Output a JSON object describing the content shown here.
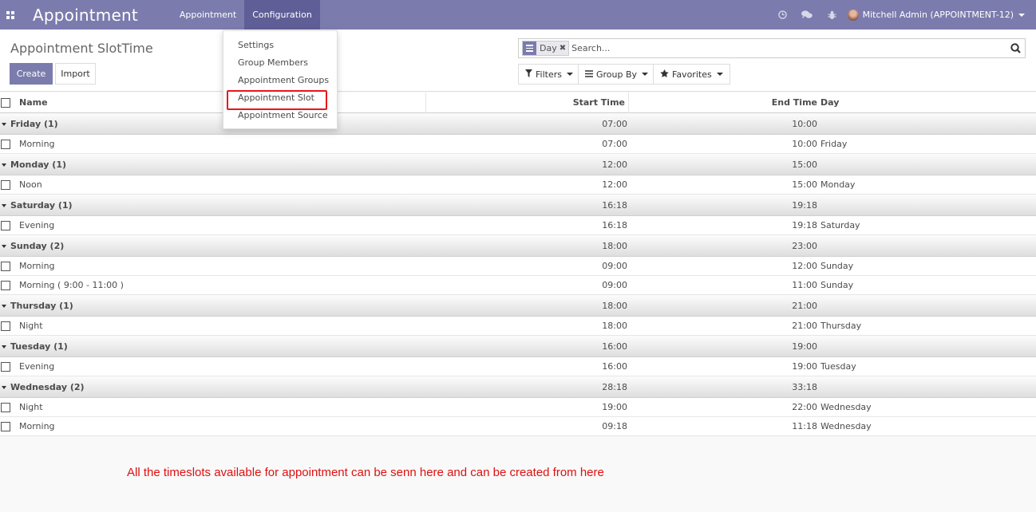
{
  "navbar": {
    "brand": "Appointment",
    "menus": [
      {
        "label": "Appointment",
        "active": false
      },
      {
        "label": "Configuration",
        "active": true
      }
    ],
    "user": "Mitchell Admin (APPOINTMENT-12)",
    "icons": [
      "apps-icon",
      "clock-icon",
      "chat-icon",
      "bug-icon"
    ]
  },
  "control": {
    "title": "Appointment SlotTime",
    "create_label": "Create",
    "import_label": "Import",
    "search": {
      "facet_value": "Day",
      "placeholder": "Search..."
    },
    "filters_label": "Filters",
    "groupby_label": "Group By",
    "favorites_label": "Favorites"
  },
  "dropdown": {
    "items": [
      "Settings",
      "Group Members",
      "Appointment Groups",
      "Appointment Slot",
      "Appointment Source"
    ],
    "highlighted": "Appointment Slot"
  },
  "table": {
    "columns": {
      "name": "Name",
      "start": "Start Time",
      "end": "End Time",
      "day": "Day"
    },
    "groups": [
      {
        "label": "Friday (1)",
        "start": "07:00",
        "end": "10:00",
        "rows": [
          {
            "name": "Morning",
            "start": "07:00",
            "end": "10:00",
            "day": "Friday"
          }
        ]
      },
      {
        "label": "Monday (1)",
        "start": "12:00",
        "end": "15:00",
        "rows": [
          {
            "name": "Noon",
            "start": "12:00",
            "end": "15:00",
            "day": "Monday"
          }
        ]
      },
      {
        "label": "Saturday (1)",
        "start": "16:18",
        "end": "19:18",
        "rows": [
          {
            "name": "Evening",
            "start": "16:18",
            "end": "19:18",
            "day": "Saturday"
          }
        ]
      },
      {
        "label": "Sunday (2)",
        "start": "18:00",
        "end": "23:00",
        "rows": [
          {
            "name": "Morning",
            "start": "09:00",
            "end": "12:00",
            "day": "Sunday"
          },
          {
            "name": "Morning ( 9:00 - 11:00 )",
            "start": "09:00",
            "end": "11:00",
            "day": "Sunday"
          }
        ]
      },
      {
        "label": "Thursday (1)",
        "start": "18:00",
        "end": "21:00",
        "rows": [
          {
            "name": "Night",
            "start": "18:00",
            "end": "21:00",
            "day": "Thursday"
          }
        ]
      },
      {
        "label": "Tuesday (1)",
        "start": "16:00",
        "end": "19:00",
        "rows": [
          {
            "name": "Evening",
            "start": "16:00",
            "end": "19:00",
            "day": "Tuesday"
          }
        ]
      },
      {
        "label": "Wednesday (2)",
        "start": "28:18",
        "end": "33:18",
        "rows": [
          {
            "name": "Night",
            "start": "19:00",
            "end": "22:00",
            "day": "Wednesday"
          },
          {
            "name": "Morning",
            "start": "09:18",
            "end": "11:18",
            "day": "Wednesday"
          }
        ]
      }
    ]
  },
  "annotation": "All the timeslots available for appointment can be senn here and can be created from here",
  "colors": {
    "primary": "#7c7bad",
    "highlight": "#e8161b",
    "note": "#e01010"
  }
}
